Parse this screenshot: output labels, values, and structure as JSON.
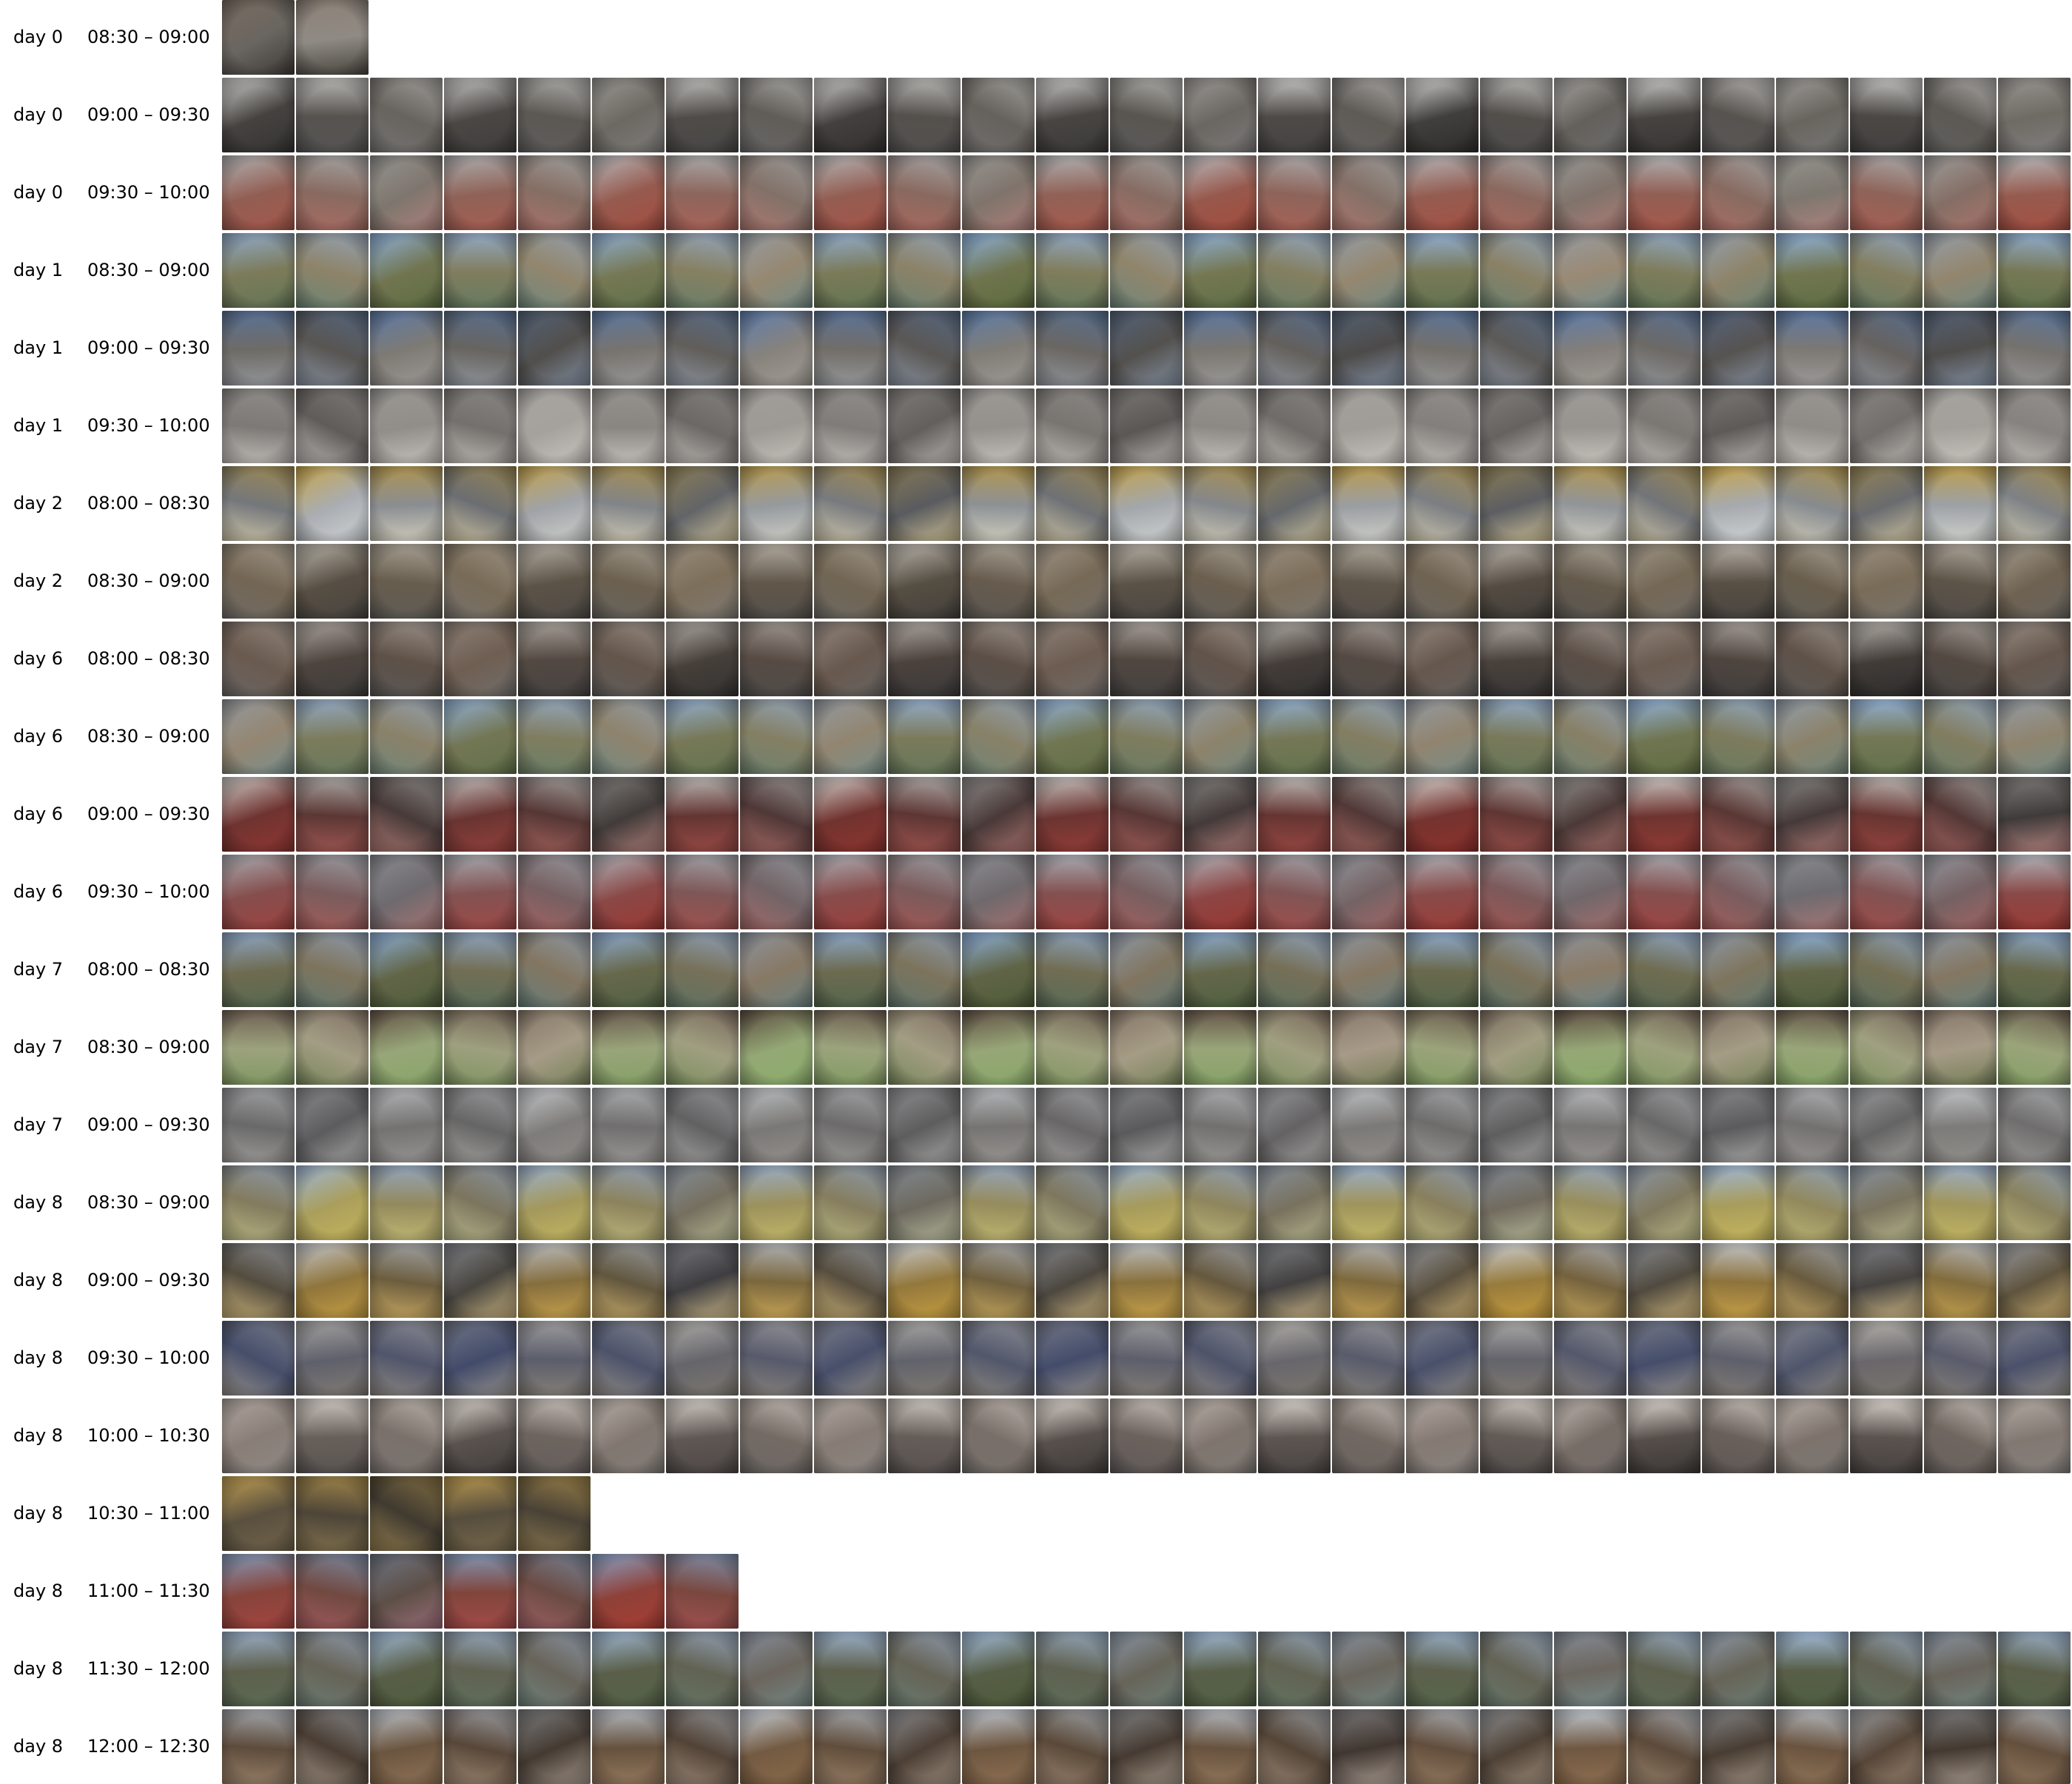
{
  "rows": [
    {
      "day": "day 0",
      "time": "08:30 – 09:00",
      "frames": 2,
      "scene": [
        "#7a6e62",
        "#cfcac2",
        "#3d3a36"
      ]
    },
    {
      "day": "day 0",
      "time": "09:00 – 09:30",
      "frames": 25,
      "scene": [
        "#d8d8d6",
        "#6e6a64",
        "#2c2a29"
      ]
    },
    {
      "day": "day 0",
      "time": "09:30 – 10:00",
      "frames": 25,
      "scene": [
        "#b9bcbf",
        "#7d776f",
        "#a44a3c"
      ]
    },
    {
      "day": "day 1",
      "time": "08:30 – 09:00",
      "frames": 25,
      "scene": [
        "#8fb3e0",
        "#9a8a74",
        "#5b6a3c"
      ]
    },
    {
      "day": "day 1",
      "time": "09:00 – 09:30",
      "frames": 25,
      "scene": [
        "#5e7fb0",
        "#4c4a48",
        "#a39d95"
      ]
    },
    {
      "day": "day 1",
      "time": "09:30 – 10:00",
      "frames": 25,
      "scene": [
        "#a8a6a2",
        "#5a5654",
        "#c9c5bf"
      ]
    },
    {
      "day": "day 2",
      "time": "08:00 – 08:30",
      "frames": 25,
      "scene": [
        "#c9a64a",
        "#585a5e",
        "#cfd4d8"
      ]
    },
    {
      "day": "day 2",
      "time": "08:30 – 09:00",
      "frames": 25,
      "scene": [
        "#bfbab2",
        "#7d6f5a",
        "#3e3a36"
      ]
    },
    {
      "day": "day 6",
      "time": "08:00 – 08:30",
      "frames": 25,
      "scene": [
        "#b8b3ad",
        "#6f5e52",
        "#2e2c2c"
      ]
    },
    {
      "day": "day 6",
      "time": "08:30 – 09:00",
      "frames": 25,
      "scene": [
        "#93b4dc",
        "#948672",
        "#5f6d42"
      ]
    },
    {
      "day": "day 6",
      "time": "09:00 – 09:30",
      "frames": 25,
      "scene": [
        "#d9d7d3",
        "#3e3b3a",
        "#8c2f2a"
      ]
    },
    {
      "day": "day 6",
      "time": "09:30 – 10:00",
      "frames": 25,
      "scene": [
        "#b3b7bd",
        "#6c6c70",
        "#9a3530"
      ]
    },
    {
      "day": "day 7",
      "time": "08:00 – 08:30",
      "frames": 25,
      "scene": [
        "#8eb2de",
        "#8c7b68",
        "#4c5a36"
      ]
    },
    {
      "day": "day 7",
      "time": "08:30 – 09:00",
      "frames": 25,
      "scene": [
        "#5b4a40",
        "#a79a88",
        "#8cae6c"
      ]
    },
    {
      "day": "day 7",
      "time": "09:00 – 09:30",
      "frames": 25,
      "scene": [
        "#c7c9cc",
        "#59585a",
        "#8f8c88"
      ]
    },
    {
      "day": "day 8",
      "time": "08:30 – 09:00",
      "frames": 25,
      "scene": [
        "#9fb7d8",
        "#6d685f",
        "#c6b65a"
      ]
    },
    {
      "day": "day 8",
      "time": "09:00 – 09:30",
      "frames": 25,
      "scene": [
        "#cfd3d8",
        "#3c3c40",
        "#c59a3a"
      ]
    },
    {
      "day": "day 8",
      "time": "09:30 – 10:00",
      "frames": 25,
      "scene": [
        "#b5b2ac",
        "#414a6a",
        "#7a746c"
      ]
    },
    {
      "day": "day 8",
      "time": "10:00 – 10:30",
      "frames": 25,
      "scene": [
        "#e3dcd6",
        "#8a7f78",
        "#3d3836"
      ]
    },
    {
      "day": "day 8",
      "time": "10:30 – 11:00",
      "frames": 5,
      "scene": [
        "#c9a655",
        "#3a352d",
        "#6c604a"
      ]
    },
    {
      "day": "day 8",
      "time": "11:00 – 11:30",
      "frames": 7,
      "scene": [
        "#8aa6cc",
        "#5a5048",
        "#a83a30"
      ]
    },
    {
      "day": "day 8",
      "time": "11:30 – 12:00",
      "frames": 25,
      "scene": [
        "#a4bede",
        "#6d6660",
        "#4d5a3a"
      ]
    },
    {
      "day": "day 8",
      "time": "12:00 – 12:30",
      "frames": 25,
      "scene": [
        "#c9d2dc",
        "#3f3630",
        "#8a6a4a"
      ]
    }
  ]
}
